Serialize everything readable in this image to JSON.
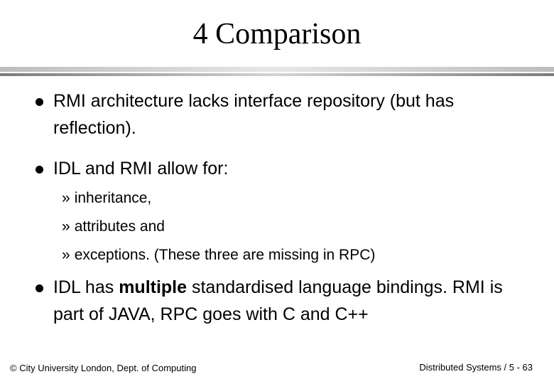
{
  "slide": {
    "title": "4 Comparison",
    "bullets": [
      {
        "text": "RMI architecture lacks interface repository (but has reflection)."
      },
      {
        "text": "IDL and RMI allow for:"
      },
      {
        "text_before": "IDL has ",
        "text_bold": "multiple",
        "text_after": " standardised language bindings. RMI is part of JAVA, RPC goes with C and C++"
      }
    ],
    "sub_bullets": [
      {
        "marker": "»",
        "text": "inheritance,"
      },
      {
        "marker": "»",
        "text": "attributes and"
      },
      {
        "marker": "»",
        "text": "exceptions. (These three are missing in RPC)"
      }
    ]
  },
  "footer": {
    "left": "© City University London, Dept. of Computing",
    "right": "Distributed Systems / 5 - 63"
  }
}
